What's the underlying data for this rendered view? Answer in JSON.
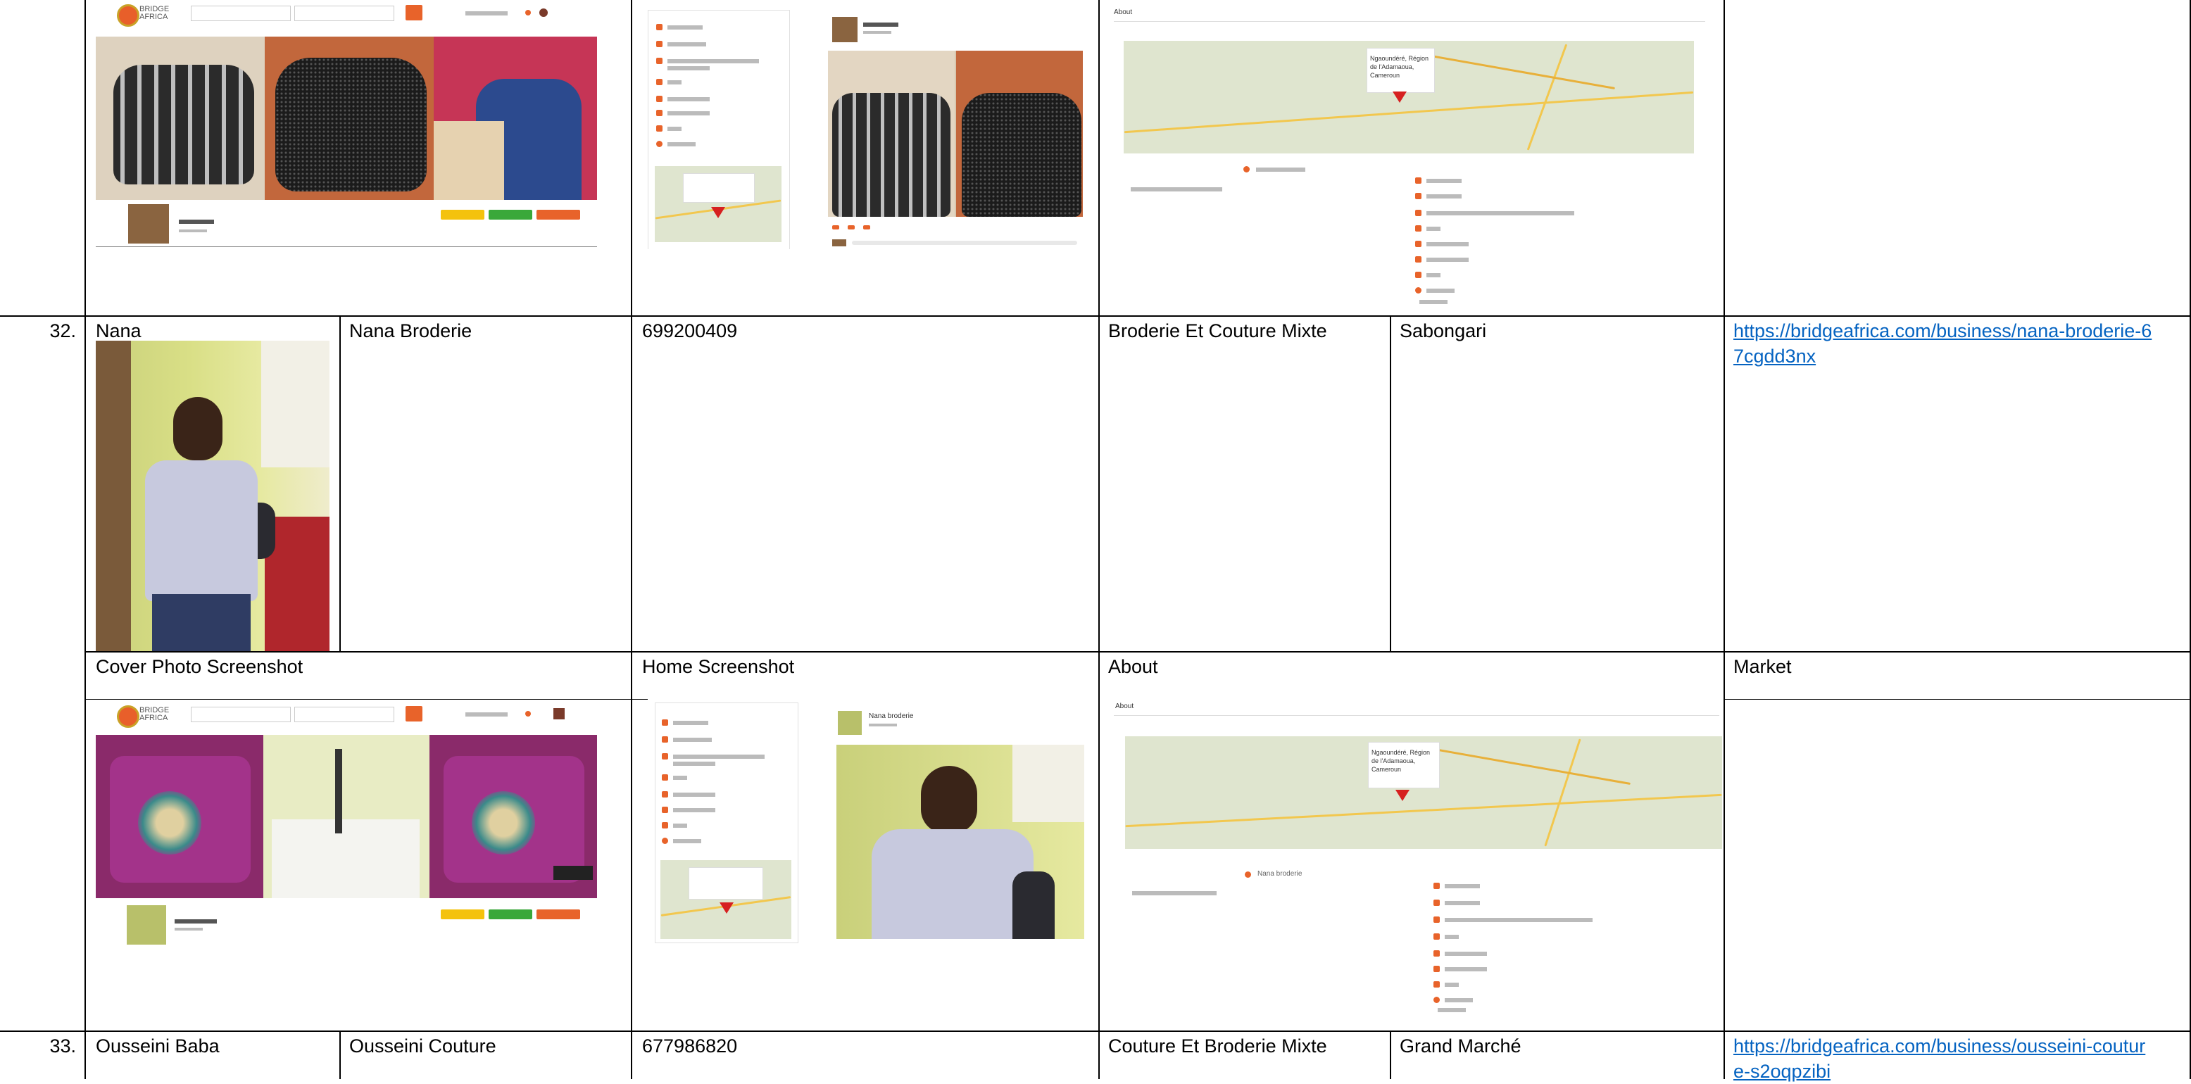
{
  "row32": {
    "number": "32.",
    "owner": "Nana",
    "business": "Nana Broderie",
    "phone": "699200409",
    "category": "Broderie Et Couture Mixte",
    "location": "Sabongari",
    "url": "https://bridgeafrica.com/business/nana-broderie-67cgdd3nx"
  },
  "headers": {
    "cover": "Cover Photo Screenshot",
    "home": "Home Screenshot",
    "about": "About",
    "market": "Market"
  },
  "row33": {
    "number": "33.",
    "owner": "Ousseini Baba",
    "business": "Ousseini Couture",
    "phone": "677986820",
    "category": "Couture Et Broderie Mixte",
    "location": "Grand Marché",
    "url": "https://bridgeafrica.com/business/ousseini-couture-s2oqpzibi"
  },
  "screenshots": {
    "logo_text": "BRIDGE AFRICA",
    "about_label": "About",
    "map_pin_text_top": "Ngaoundéré, Région de l'Adamaoua, Cameroun",
    "nana_profile_name": "Nana broderie",
    "map_place_name": "Nana broderie"
  },
  "colors": {
    "accent": "#e8632a",
    "link": "#0563C1",
    "btn_yellow": "#f4c20d",
    "btn_green": "#3aa83a",
    "btn_orange": "#e8632a"
  }
}
